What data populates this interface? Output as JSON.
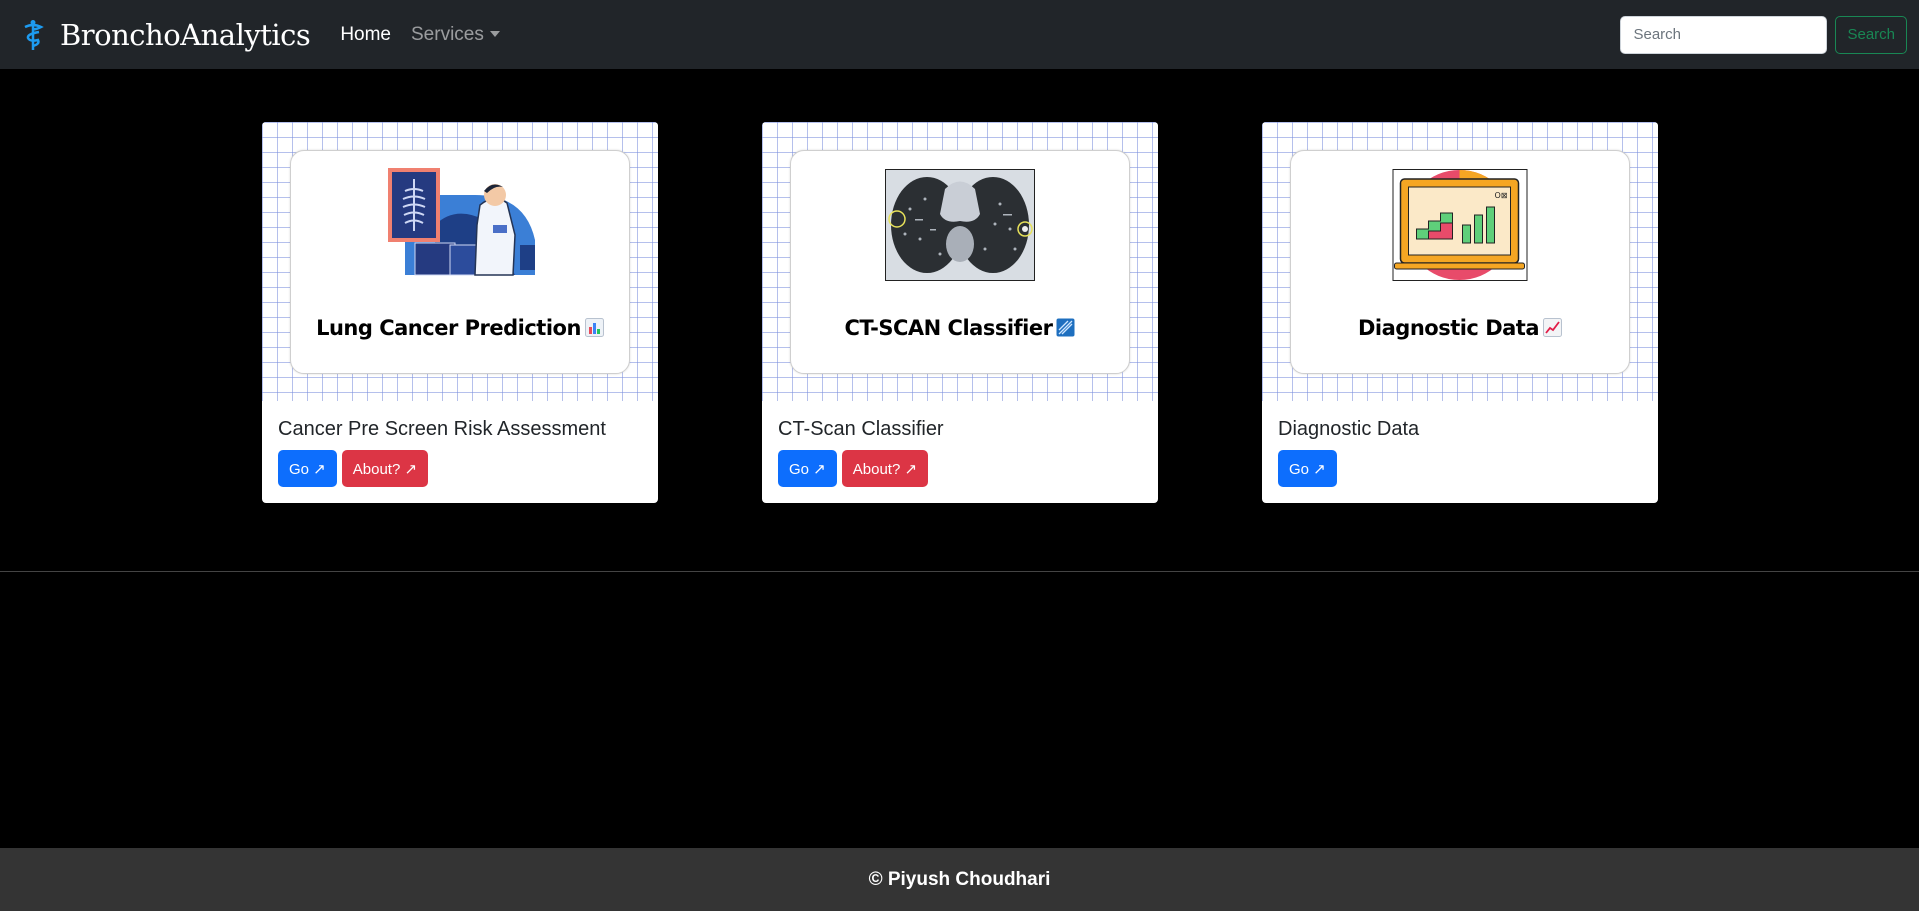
{
  "navbar": {
    "brand": "BronchoAnalytics",
    "brand_icon": "caduceus-icon",
    "links": [
      {
        "label": "Home",
        "active": true
      },
      {
        "label": "Services",
        "dropdown": true
      }
    ],
    "search_placeholder": "Search",
    "search_button": "Search"
  },
  "cards": [
    {
      "heading": "Lung Cancer Prediction",
      "heading_emoji": "bar-chart-icon",
      "illustration": "doctor-xray-icon",
      "title": "Cancer Pre Screen Risk Assessment",
      "buttons": [
        {
          "label": "Go ↗",
          "style": "primary"
        },
        {
          "label": "About? ↗",
          "style": "danger"
        }
      ]
    },
    {
      "heading": "CT-SCAN Classifier",
      "heading_emoji": "ct-scan-icon",
      "illustration": "lung-ct-scan-icon",
      "title": "CT-Scan Classifier",
      "buttons": [
        {
          "label": "Go ↗",
          "style": "primary"
        },
        {
          "label": "About? ↗",
          "style": "danger"
        }
      ]
    },
    {
      "heading": "Diagnostic Data",
      "heading_emoji": "chart-increasing-icon",
      "illustration": "laptop-analytics-icon",
      "title": "Diagnostic Data",
      "buttons": [
        {
          "label": "Go ↗",
          "style": "primary"
        }
      ]
    }
  ],
  "footer": {
    "text": "© Piyush Choudhari"
  },
  "colors": {
    "navbar_bg": "#212529",
    "primary": "#0d6efd",
    "danger": "#dc3545",
    "success_outline": "#198754",
    "footer_bg": "#343434",
    "page_bg": "#000000"
  }
}
